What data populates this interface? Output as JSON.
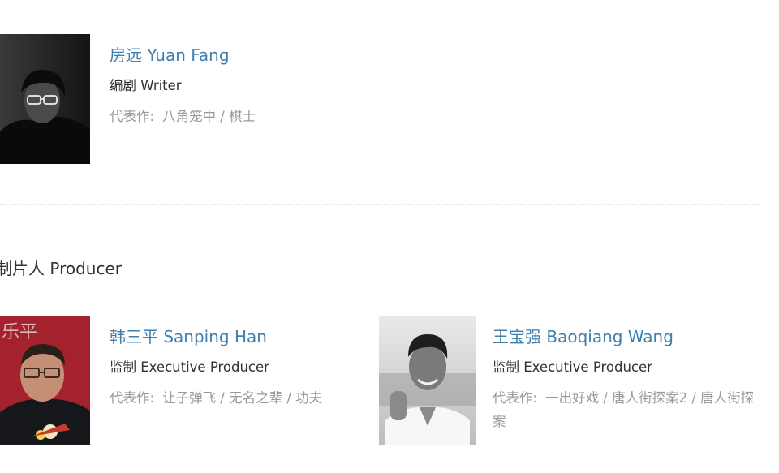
{
  "writers": [
    {
      "name": "房远 Yuan Fang",
      "role": "编剧 Writer",
      "works_prefix": "代表作:",
      "works": "八角笼中 / 棋士"
    }
  ],
  "producers_section": {
    "title": "制片人 Producer",
    "people": [
      {
        "name": "韩三平 Sanping Han",
        "role": "监制 Executive Producer",
        "works_prefix": "代表作:",
        "works": "让子弹飞 / 无名之辈 / 功夫"
      },
      {
        "name": "王宝强 Baoqiang Wang",
        "role": "监制 Executive Producer",
        "works_prefix": "代表作:",
        "works": "一出好戏 / 唐人街探案2 / 唐人街探案"
      }
    ]
  }
}
